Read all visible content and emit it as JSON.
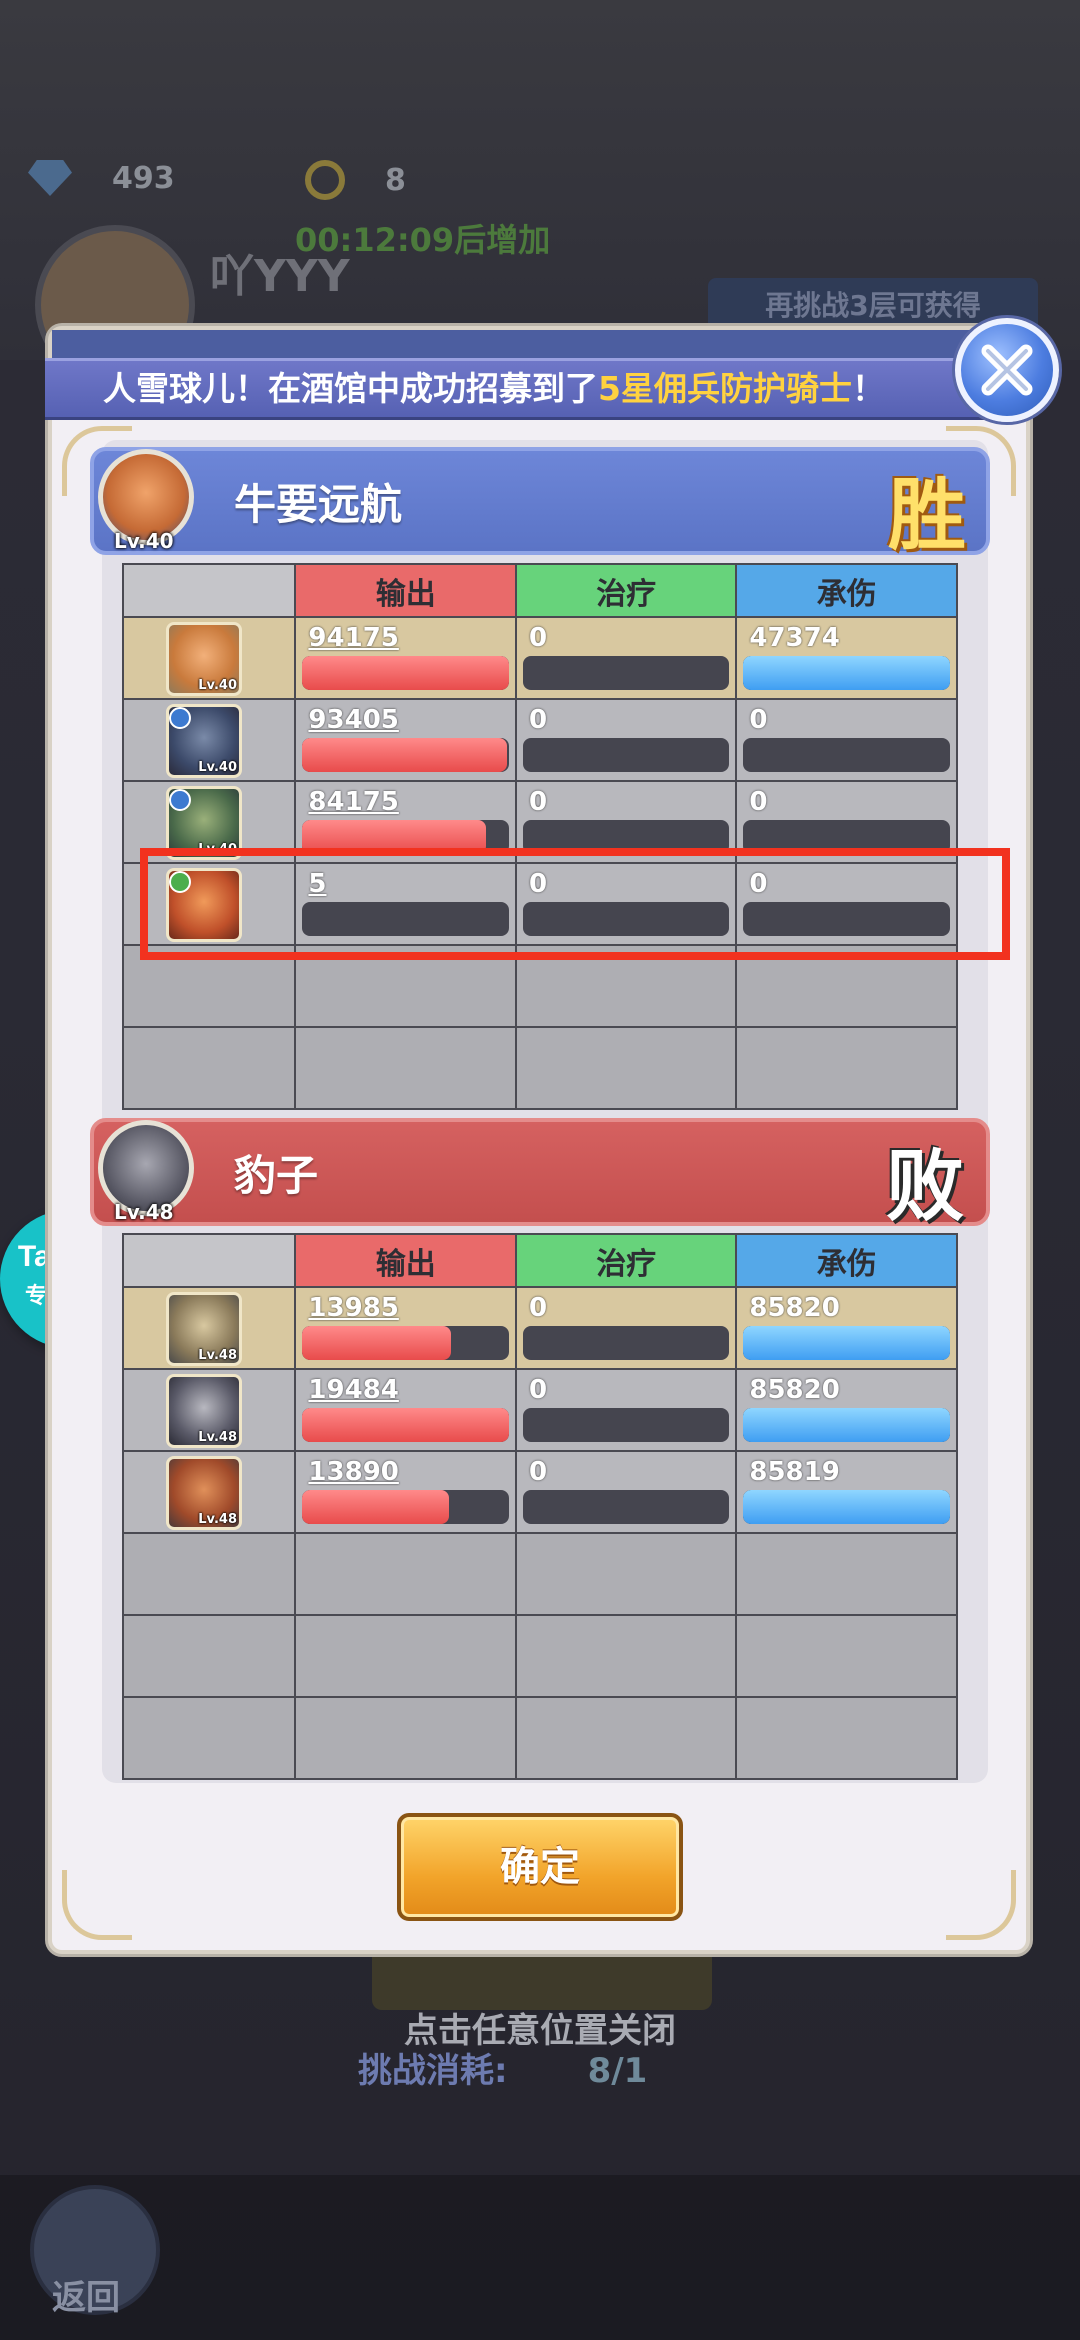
{
  "background": {
    "gems": "493",
    "keys": "8",
    "timer": "00:12:09后增加",
    "player_name": "吖YYY",
    "chip_label": "再挑战3层可获得",
    "hint": "点击任意位置关闭",
    "cost_label": "挑战消耗:",
    "cost_value": "8/1",
    "back_label": "返回"
  },
  "taptap": {
    "brand": "TapTap",
    "label": "专属活动"
  },
  "banner": {
    "part1": "人雪球儿！在酒馆中成功招募到了",
    "star": "5星佣兵",
    "hero": "防护骑士",
    "end": "！"
  },
  "winner": {
    "name": "牛要远航",
    "level": "Lv.40",
    "result": "胜",
    "rows": [
      {
        "level": "Lv.40",
        "damage": "94175",
        "damage_pct": 100,
        "heal": "0",
        "tank": "47374",
        "tank_pct": 100
      },
      {
        "level": "Lv.40",
        "damage": "93405",
        "damage_pct": 99,
        "heal": "0",
        "tank": "0",
        "tank_pct": 0
      },
      {
        "level": "Lv.40",
        "damage": "84175",
        "damage_pct": 89,
        "heal": "0",
        "tank": "0",
        "tank_pct": 0
      },
      {
        "level": "",
        "damage": "5",
        "damage_pct": 0,
        "heal": "0",
        "tank": "0",
        "tank_pct": 0
      }
    ]
  },
  "loser": {
    "name": "豹子",
    "level": "Lv.48",
    "result": "败",
    "rows": [
      {
        "level": "Lv.48",
        "damage": "13985",
        "damage_pct": 72,
        "heal": "0",
        "tank": "85820",
        "tank_pct": 100
      },
      {
        "level": "Lv.48",
        "damage": "19484",
        "damage_pct": 100,
        "heal": "0",
        "tank": "85820",
        "tank_pct": 100
      },
      {
        "level": "Lv.48",
        "damage": "13890",
        "damage_pct": 71,
        "heal": "0",
        "tank": "85819",
        "tank_pct": 100
      }
    ]
  },
  "columns": {
    "damage": "输出",
    "heal": "治疗",
    "tank": "承伤"
  },
  "confirm_label": "确定",
  "colors": {
    "damage": "#e96a6a",
    "heal": "#67d37b",
    "tank": "#55a8e8",
    "win": "#5b74c6",
    "lose": "#c44f4e",
    "highlight": "#f2321f"
  }
}
